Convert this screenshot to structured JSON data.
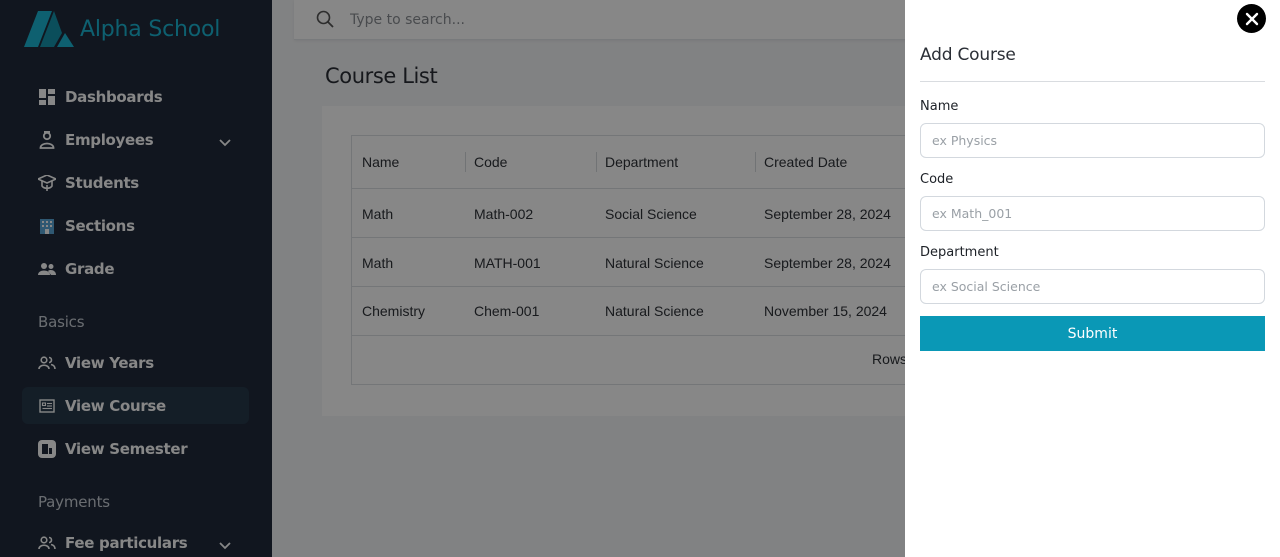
{
  "app": {
    "name": "Alpha School",
    "brand_color": "#1bb6d3",
    "sidebar_bg": "#202b3c"
  },
  "sidebar": {
    "items": [
      {
        "label": "Dashboards",
        "icon": "dashboard-icon"
      },
      {
        "label": "Employees",
        "icon": "employees-icon",
        "expandable": true
      },
      {
        "label": "Students",
        "icon": "students-icon"
      },
      {
        "label": "Sections",
        "icon": "sections-icon"
      },
      {
        "label": "Grade",
        "icon": "grade-icon"
      }
    ],
    "basics_title": "Basics",
    "basics": [
      {
        "label": "View Years",
        "icon": "users-icon"
      },
      {
        "label": "View Course",
        "icon": "course-icon",
        "active": true
      },
      {
        "label": "View Semester",
        "icon": "semester-icon"
      }
    ],
    "payments_title": "Payments",
    "payments": [
      {
        "label": "Fee particulars",
        "icon": "users-icon",
        "expandable": true
      }
    ]
  },
  "search": {
    "placeholder": "Type to search..."
  },
  "page": {
    "title": "Course List",
    "table": {
      "columns": [
        "Name",
        "Code",
        "Department",
        "Created Date"
      ],
      "rows": [
        [
          "Math",
          "Math-002",
          "Social Science",
          "September 28, 2024"
        ],
        [
          "Math",
          "MATH-001",
          "Natural Science",
          "September 28, 2024"
        ],
        [
          "Chemistry",
          "Chem-001",
          "Natural Science",
          "November 15, 2024"
        ]
      ],
      "footer_label": "Rows"
    }
  },
  "drawer": {
    "title": "Add Course",
    "fields": [
      {
        "label": "Name",
        "placeholder": "ex Physics"
      },
      {
        "label": "Code",
        "placeholder": "ex Math_001"
      },
      {
        "label": "Department",
        "placeholder": "ex Social Science"
      }
    ],
    "submit_label": "Submit",
    "accent_color": "#0a98b6"
  }
}
